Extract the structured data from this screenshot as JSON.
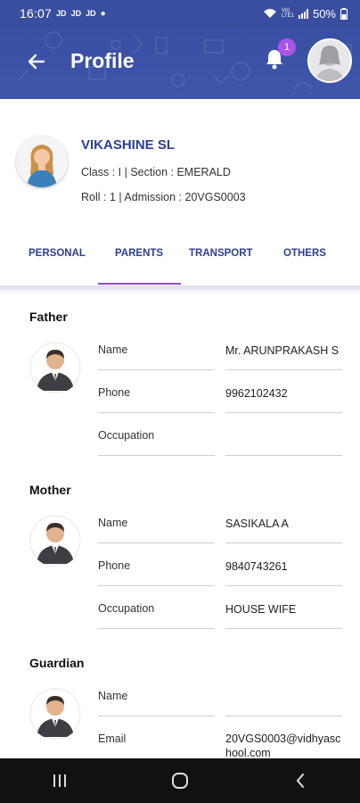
{
  "status_bar": {
    "time": "16:07",
    "indicators": [
      "JD",
      "JD",
      "JD"
    ],
    "battery": "50%",
    "network_label": "Vo) LTE1"
  },
  "header": {
    "title": "Profile",
    "back_icon": "arrow-left-icon",
    "notification_icon": "bell-icon",
    "notification_count": "1",
    "avatar_icon": "user-avatar",
    "accent_color": "#3a4ea2"
  },
  "student": {
    "name": "VIKASHINE SL",
    "class_section": "Class : I | Section : EMERALD",
    "roll_admission": "Roll : 1 | Admission : 20VGS0003"
  },
  "tabs": {
    "items": [
      "PERSONAL",
      "PARENTS",
      "TRANSPORT",
      "OTHERS"
    ],
    "active": "PARENTS"
  },
  "parents": {
    "father": {
      "title": "Father",
      "fields": [
        {
          "label": "Name",
          "value": "Mr. ARUNPRAKASH S"
        },
        {
          "label": "Phone",
          "value": "9962102432"
        },
        {
          "label": "Occupation",
          "value": ""
        }
      ]
    },
    "mother": {
      "title": "Mother",
      "fields": [
        {
          "label": "Name",
          "value": "SASIKALA A"
        },
        {
          "label": "Phone",
          "value": "9840743261"
        },
        {
          "label": "Occupation",
          "value": "HOUSE WIFE"
        }
      ]
    },
    "guardian": {
      "title": "Guardian",
      "fields": [
        {
          "label": "Name",
          "value": ""
        },
        {
          "label": "Email",
          "value": "20VGS0003@vidhyaschool.com"
        }
      ]
    }
  },
  "nav_bar": {
    "items": [
      "recent-apps-icon",
      "home-icon",
      "back-icon"
    ]
  }
}
